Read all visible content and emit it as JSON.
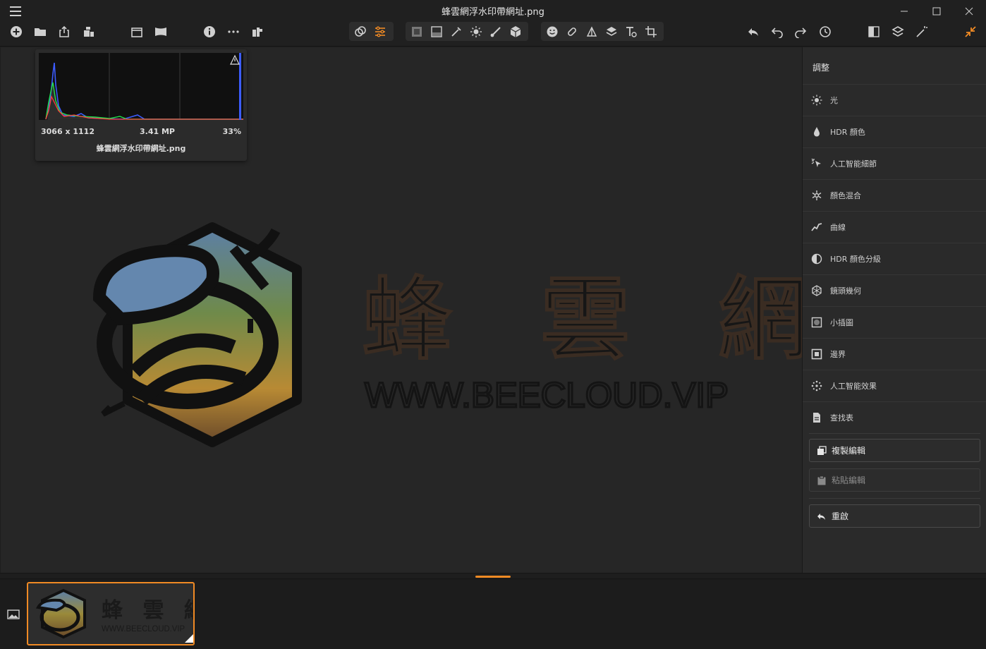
{
  "window": {
    "title": "蜂雲網浮水印帶網址.png"
  },
  "histogram": {
    "dimensions": "3066 x 1112",
    "megapixels": "3.41 MP",
    "zoom": "33%",
    "filename": "蜂雲網浮水印帶網址.png"
  },
  "watermark": {
    "chinese_text": "蜂 雲 網",
    "url_text": "WWW.BEECLOUD.VIP"
  },
  "panel": {
    "heading": "調整",
    "items": [
      {
        "label": "光",
        "icon": "sun-icon"
      },
      {
        "label": "HDR 顏色",
        "icon": "droplet-icon"
      },
      {
        "label": "人工智能細節",
        "icon": "ai-sparkle-icon"
      },
      {
        "label": "顏色混合",
        "icon": "color-mix-icon"
      },
      {
        "label": "曲線",
        "icon": "curve-icon"
      },
      {
        "label": "HDR 顏色分級",
        "icon": "color-grading-icon"
      },
      {
        "label": "鏡頭幾何",
        "icon": "lens-geometry-icon"
      },
      {
        "label": "小插圖",
        "icon": "vignette-icon"
      },
      {
        "label": "邊界",
        "icon": "border-icon"
      },
      {
        "label": "人工智能效果",
        "icon": "ai-effects-icon"
      },
      {
        "label": "查找表",
        "icon": "lut-file-icon"
      }
    ],
    "copy_edits": "複製編輯",
    "paste_edits": "粘貼編輯",
    "reset": "重啟"
  },
  "thumbnail": {
    "chinese_text": "蜂 雲 網",
    "url_text": "WWW.BEECLOUD.VIP"
  },
  "colors": {
    "accent": "#f08a24",
    "background": "#1e1e1e",
    "panel": "#2a2a2a",
    "canvas": "#262626"
  }
}
